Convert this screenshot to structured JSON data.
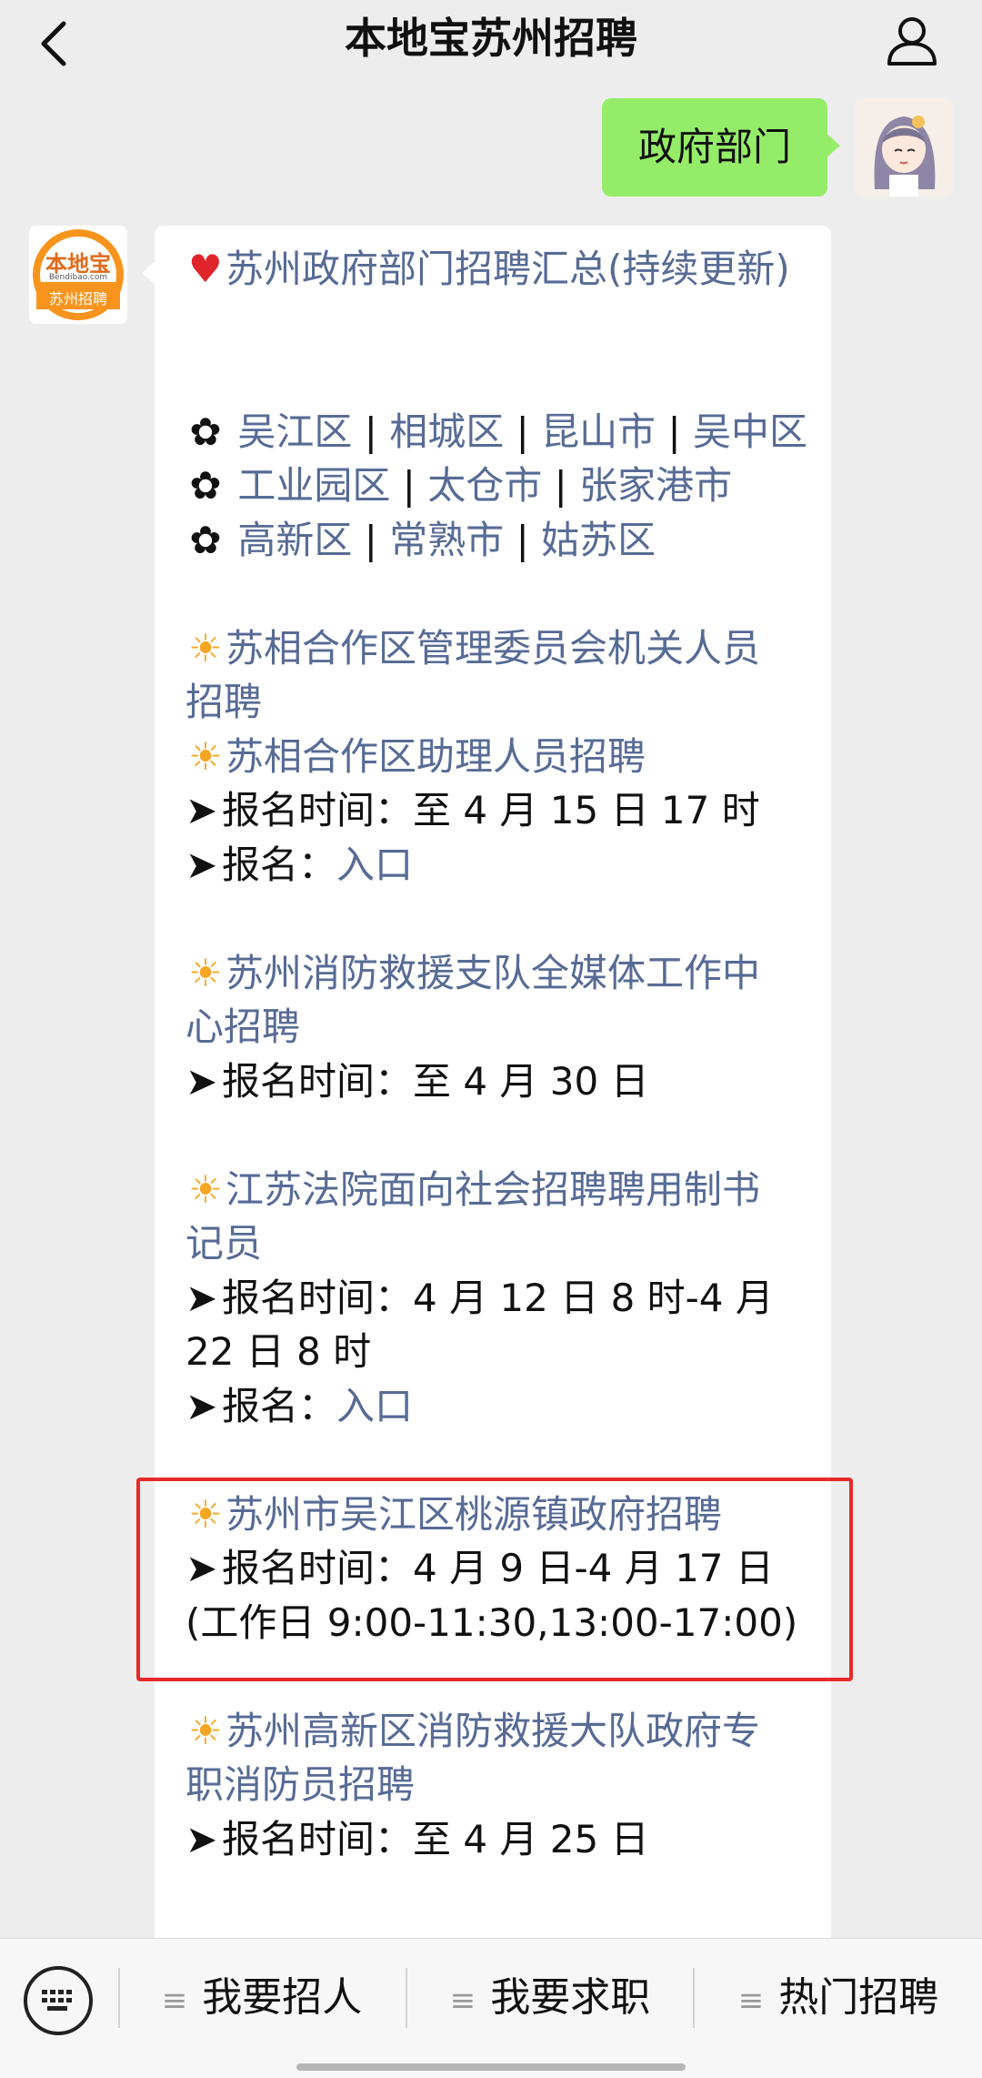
{
  "header": {
    "title": "本地宝苏州招聘"
  },
  "outgoing": {
    "text": "政府部门"
  },
  "bot": {
    "logo_top": "本地宝",
    "logo_mid": "Bendibao.com",
    "logo_bottom": "苏州招聘"
  },
  "message": {
    "heading": "苏州政府部门招聘汇总(持续更新)",
    "districts": [
      [
        "吴江区",
        "相城区",
        "昆山市",
        "吴中区"
      ],
      [
        "工业园区",
        "太仓市",
        "张家港市"
      ],
      [
        "高新区",
        "常熟市",
        "姑苏区"
      ]
    ],
    "items": [
      {
        "titles": [
          "苏相合作区管理委员会机关人员",
          "招聘"
        ]
      },
      {
        "titles": [
          "苏相合作区助理人员招聘"
        ]
      },
      {
        "lines": [
          "报名时间：至 4 月 15 日 17 时"
        ]
      },
      {
        "label": "报名：",
        "link": "入口"
      },
      {
        "titles": [
          "苏州消防救援支队全媒体工作中",
          "心招聘"
        ]
      },
      {
        "lines": [
          "报名时间：至 4 月 30 日"
        ]
      },
      {
        "titles": [
          "江苏法院面向社会招聘聘用制书",
          "记员"
        ]
      },
      {
        "lines": [
          "报名时间：4 月 12 日 8 时-4 月",
          "22 日 8 时"
        ]
      },
      {
        "label": "报名：",
        "link": "入口"
      },
      {
        "titles": [
          "苏州市吴江区桃源镇政府招聘"
        ]
      },
      {
        "lines": [
          "报名时间：4 月 9 日-4 月 17 日",
          "(工作日 9:00-11:30,13:00-17:00)"
        ]
      },
      {
        "titles": [
          "苏州高新区消防救援大队政府专",
          "职消防员招聘"
        ]
      },
      {
        "lines": [
          "报名时间：至 4 月 25 日"
        ]
      }
    ]
  },
  "bottom_menu": {
    "items": [
      "我要招人",
      "我要求职",
      "热门招聘"
    ]
  },
  "colors": {
    "link": "#576b95",
    "bubble_out": "#95ec69",
    "highlight": "#e8292a"
  }
}
